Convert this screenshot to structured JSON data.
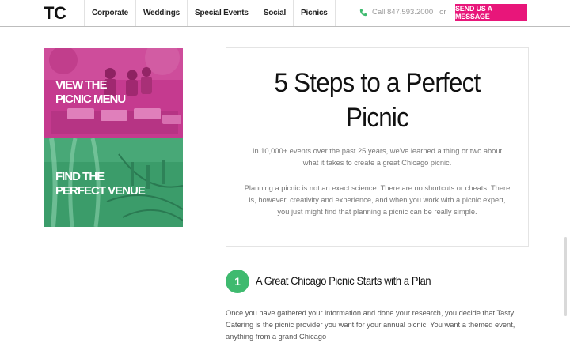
{
  "header": {
    "logo": "TC",
    "nav": [
      "Corporate",
      "Weddings",
      "Special Events",
      "Social",
      "Picnics"
    ],
    "phone_text": "Call 847.593.2000",
    "or_text": "or",
    "cta_label": "SEND US A MESSAGE"
  },
  "tiles": {
    "menu_line1": "VIEW THE",
    "menu_line2": "PICNIC MENU",
    "venue_line1": "FIND THE",
    "venue_line2": "PERFECT VENUE"
  },
  "intro": {
    "title_line1": "5 Steps to a Perfect",
    "title_line2": "Picnic",
    "p1": "In 10,000+ events over the past 25 years, we've learned a thing or two about what it takes to create a great Chicago picnic.",
    "p2": "Planning a picnic is not an exact science. There are no shortcuts or cheats. There is, however, creativity and experience, and when you work with a picnic expert, you just might find that planning a picnic can be really simple."
  },
  "step": {
    "number": "1",
    "title": "A Great Chicago Picnic Starts with a Plan",
    "body": "Once you have gathered your information and done your research, you decide that Tasty Catering is the picnic provider you want for your annual picnic. You want a themed event, anything from a grand Chicago"
  },
  "colors": {
    "accent_pink": "#e8167a",
    "tile_pink": "#c53a8f",
    "tile_green": "#3b9c6a",
    "badge_green": "#3fba6f"
  },
  "icons": {
    "phone": "phone-icon"
  }
}
